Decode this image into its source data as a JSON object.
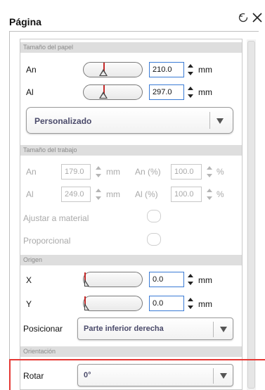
{
  "title": "Página",
  "icons": {
    "reset": "reset-icon",
    "close": "close-icon"
  },
  "colors": {
    "accent_red": "#e53935",
    "focus_blue": "#3a7bd5",
    "marker_red": "#c62828"
  },
  "paper": {
    "section": "Tamaño del papel",
    "width_label": "An",
    "width_value": "210.0",
    "height_label": "Al",
    "height_value": "297.0",
    "unit": "mm",
    "preset": "Personalizado"
  },
  "work": {
    "section": "Tamaño del trabajo",
    "an_label": "An",
    "an_value": "179.0",
    "an_unit": "mm",
    "an_pct_label": "An (%)",
    "an_pct_value": "100.0",
    "pct_unit": "%",
    "al_label": "Al",
    "al_value": "249.0",
    "al_unit": "mm",
    "al_pct_label": "Al (%)",
    "al_pct_value": "100.0",
    "fit_label": "Ajustar a material",
    "proportional_label": "Proporcional"
  },
  "origin": {
    "section": "Origen",
    "x_label": "X",
    "x_value": "0.0",
    "y_label": "Y",
    "y_value": "0.0",
    "unit": "mm",
    "position_label": "Posicionar",
    "position_value": "Parte inferior derecha"
  },
  "orientation": {
    "section": "Orientación",
    "rotate_label": "Rotar",
    "rotate_value": "0°"
  }
}
